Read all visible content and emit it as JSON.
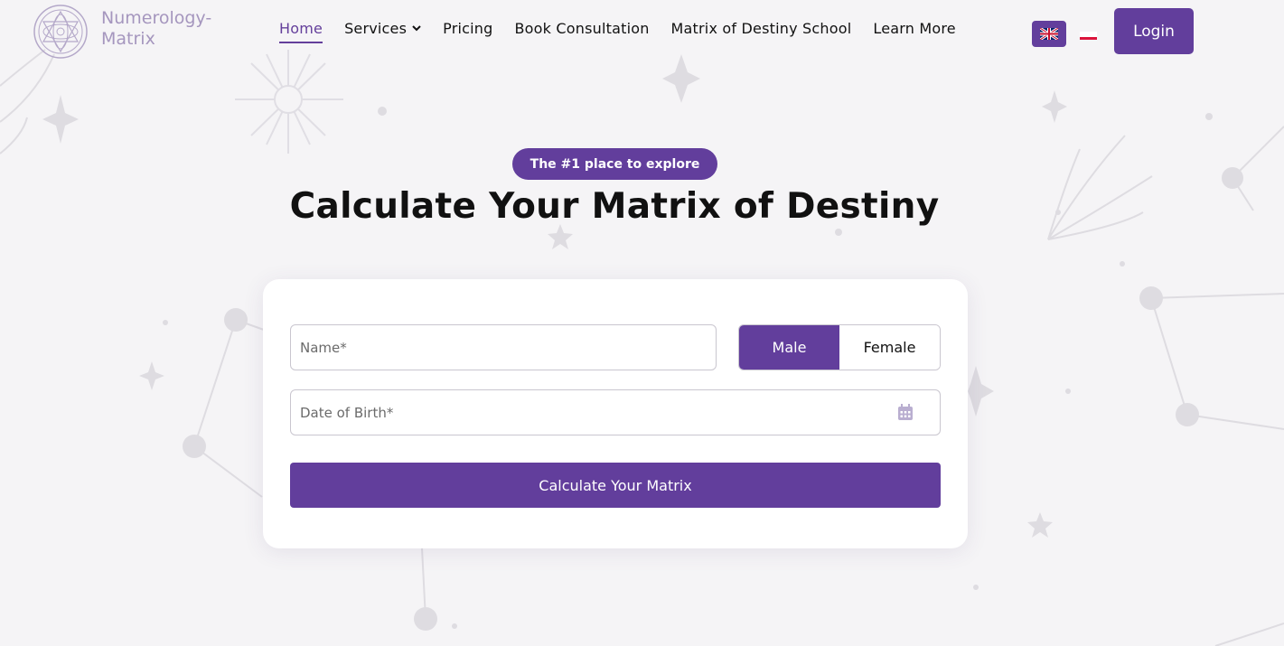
{
  "brand": {
    "name_line1": "Numerology-",
    "name_line2": "Matrix"
  },
  "nav": {
    "items": [
      {
        "label": "Home",
        "active": true
      },
      {
        "label": "Services",
        "has_dropdown": true
      },
      {
        "label": "Pricing"
      },
      {
        "label": "Book Consultation"
      },
      {
        "label": "Matrix of Destiny School"
      },
      {
        "label": "Learn More"
      }
    ]
  },
  "languages": [
    {
      "icon": "uk-flag-icon",
      "selected": true
    },
    {
      "icon": "poland-flag-icon",
      "selected": false
    }
  ],
  "header": {
    "login_label": "Login"
  },
  "hero": {
    "badge": "The #1 place to explore",
    "title": "Calculate Your Matrix of Destiny"
  },
  "form": {
    "name_placeholder": "Name*",
    "name_value": "",
    "dob_placeholder": "Date of Birth*",
    "dob_value": "",
    "gender": {
      "options": [
        "Male",
        "Female"
      ],
      "selected": "Male"
    },
    "submit_label": "Calculate Your Matrix"
  },
  "colors": {
    "accent": "#623e9c",
    "background": "#f5f4f6",
    "logo_text": "#a596be"
  }
}
